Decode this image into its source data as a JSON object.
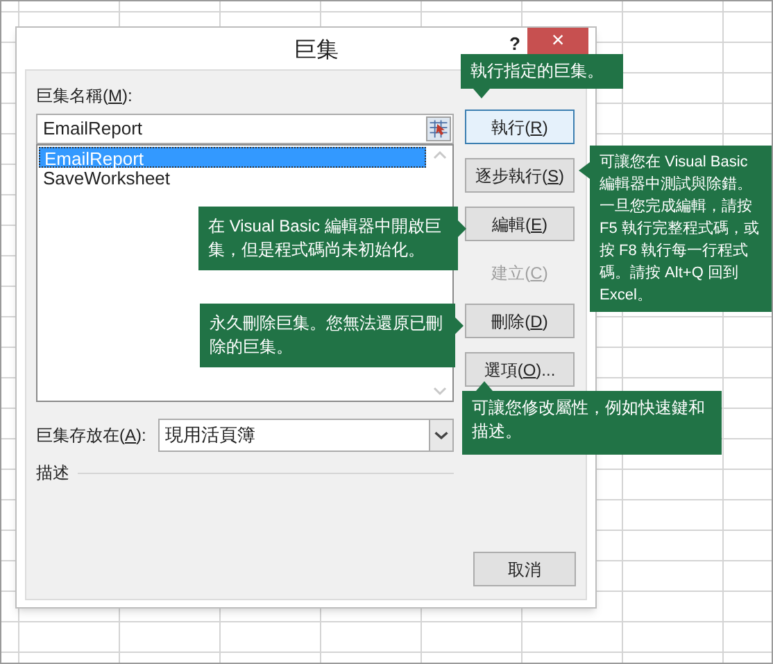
{
  "dialog": {
    "title": "巨集",
    "help": "?",
    "close": "×"
  },
  "name_label": {
    "before": "巨集名稱(",
    "mnemonic": "M",
    "after": "):"
  },
  "name_field": {
    "value": "EmailReport"
  },
  "macros": [
    {
      "name": "EmailReport",
      "selected": true
    },
    {
      "name": "SaveWorksheet",
      "selected": false
    }
  ],
  "buttons": [
    {
      "before": "執行(",
      "mnemonic": "R",
      "after": ")",
      "disabled": false,
      "focused": true
    },
    {
      "before": "逐步執行(",
      "mnemonic": "S",
      "after": ")",
      "disabled": false,
      "focused": false
    },
    {
      "before": "編輯(",
      "mnemonic": "E",
      "after": ")",
      "disabled": false,
      "focused": false
    },
    {
      "before": "建立(",
      "mnemonic": "C",
      "after": ")",
      "disabled": true,
      "focused": false
    },
    {
      "before": "刪除(",
      "mnemonic": "D",
      "after": ")",
      "disabled": false,
      "focused": false
    },
    {
      "before": "選項(",
      "mnemonic": "O",
      "after": ")...",
      "disabled": false,
      "focused": false
    }
  ],
  "location_label": {
    "before": "巨集存放在(",
    "mnemonic": "A",
    "after": "):"
  },
  "location_select": {
    "value": "現用活頁簿"
  },
  "description_label": "描述",
  "cancel": "取消",
  "callouts": [
    {
      "text": "執行指定的巨集。",
      "kind": "down"
    },
    {
      "text": "可讓您在 Visual Basic 編輯器中測試與除錯。一旦您完成編輯，請按 F5 執行完整程式碼，或按 F8 執行每一行程式碼。請按 Alt+Q 回到 Excel。",
      "kind": "left"
    },
    {
      "text": "在 Visual Basic 編輯器中開啟巨集，但是程式碼尚未初始化。",
      "kind": "right"
    },
    {
      "text": "永久刪除巨集。您無法還原已刪除的巨集。",
      "kind": "right"
    },
    {
      "text": "可讓您修改屬性，例如快速鍵和描述。",
      "kind": "up"
    }
  ]
}
